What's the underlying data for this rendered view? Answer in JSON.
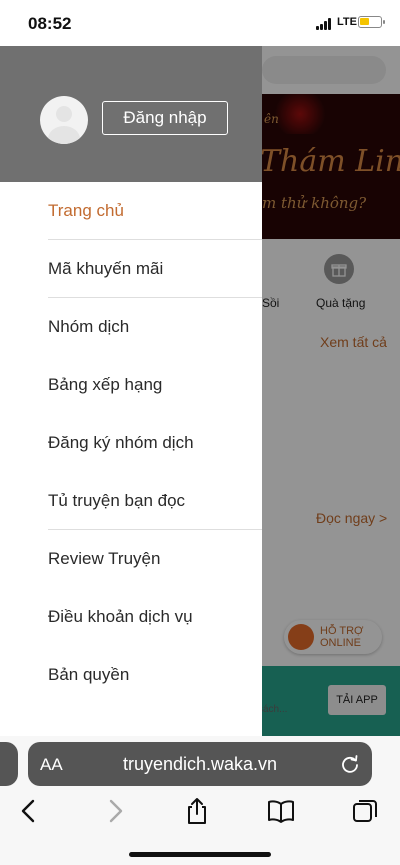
{
  "status_bar": {
    "time": "08:52",
    "network": "LTE",
    "battery_color": "#f5c400"
  },
  "drawer": {
    "login_label": "Đăng nhập",
    "menu_items": [
      {
        "label": "Trang chủ",
        "active": true
      },
      {
        "label": "Mã khuyến mãi",
        "active": false
      },
      {
        "label": "Nhóm dịch",
        "active": false
      },
      {
        "label": "Bảng xếp hạng",
        "active": false
      },
      {
        "label": "Đăng ký nhóm dịch",
        "active": false
      },
      {
        "label": "Tủ truyện bạn đọc",
        "active": false
      },
      {
        "label": "Review Truyện",
        "active": false
      },
      {
        "label": "Điều khoản dịch vụ",
        "active": false
      },
      {
        "label": "Bản quyền",
        "active": false
      }
    ],
    "active_color": "#c26b30",
    "header_color": "#707070"
  },
  "background_page": {
    "banner_top": "ên",
    "banner_title": "Thám Linh Dị",
    "banner_subtitle": "m thử không?",
    "soi_label": "Sồi",
    "gift_label": "Quà tặng",
    "see_all": "Xem tất cả",
    "read_now": "Đọc ngay >",
    "support_line1": "HỖ TRỢ",
    "support_line2": "ONLINE",
    "bottom_hint": "sách...",
    "download_label": "TẢI APP"
  },
  "browser": {
    "aa_label": "AA",
    "url": "truyendich.waka.vn"
  }
}
